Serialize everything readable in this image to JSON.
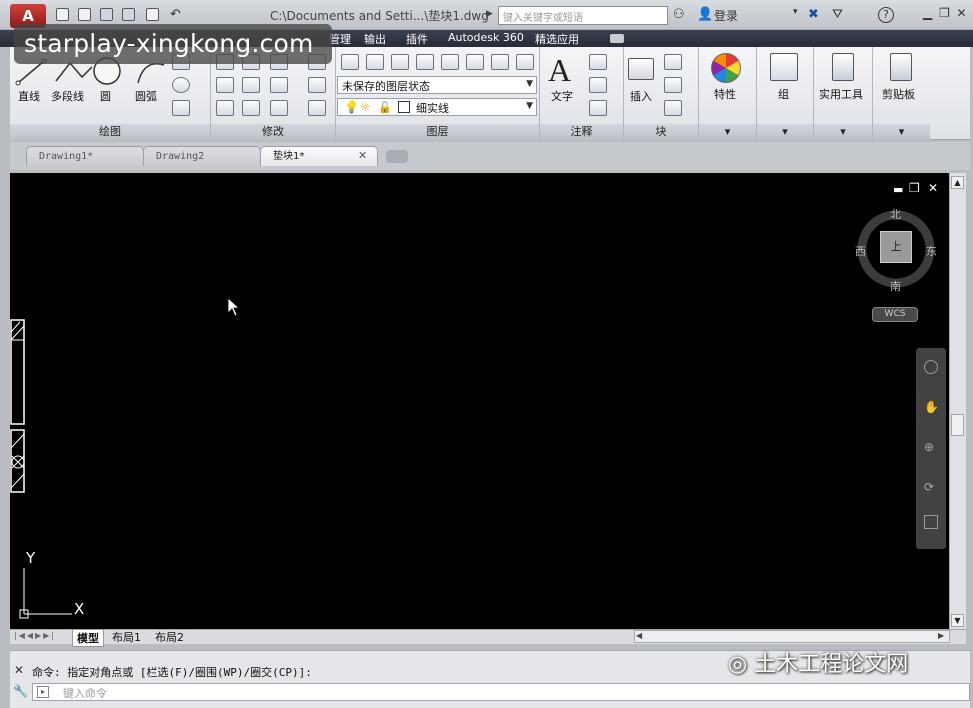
{
  "titlebar": {
    "app_letter": "A",
    "title": "C:\\Documents and Setti...\\垫块1.dwg",
    "search_placeholder": "键入关键字或短语",
    "login": "登录",
    "help": "?"
  },
  "watermark": "starplay-xingkong.com",
  "ribbon_tabs": [
    "管理",
    "输出",
    "插件",
    "Autodesk 360",
    "精选应用"
  ],
  "ribbon": {
    "draw": {
      "line": "直线",
      "polyline": "多段线",
      "circle": "圆",
      "arc": "圆弧",
      "title": "绘图"
    },
    "modify": {
      "title": "修改"
    },
    "layers": {
      "layer_state": "未保存的图层状态",
      "current_layer": "细实线",
      "title": "图层"
    },
    "annotation": {
      "text": "文字",
      "title": "注释"
    },
    "block": {
      "insert": "插入",
      "title": "块"
    },
    "properties": "特性",
    "groups": "组",
    "utilities": "实用工具",
    "clipboard": "剪贴板"
  },
  "doc_tabs": [
    {
      "label": "Drawing1*",
      "active": false
    },
    {
      "label": "Drawing2",
      "active": false
    },
    {
      "label": "垫块1*",
      "active": true
    }
  ],
  "viewcube": {
    "north": "北",
    "south": "南",
    "east": "东",
    "west": "西",
    "top": "上",
    "ucs": "WCS"
  },
  "ucs_axes": {
    "x": "X",
    "y": "Y"
  },
  "layout_tabs": [
    "模型",
    "布局1",
    "布局2"
  ],
  "command": {
    "label": "命令:",
    "prompt": "指定对角点或 [栏选(F)/圈围(WP)/圈交(CP)]:",
    "input_placeholder": "键入命令"
  },
  "wechat_watermark": "土木工程论文网",
  "colors": {
    "canvas": "#000000",
    "app_button": "#b92c26",
    "ribbon_tab_bar": "#2f3541"
  }
}
